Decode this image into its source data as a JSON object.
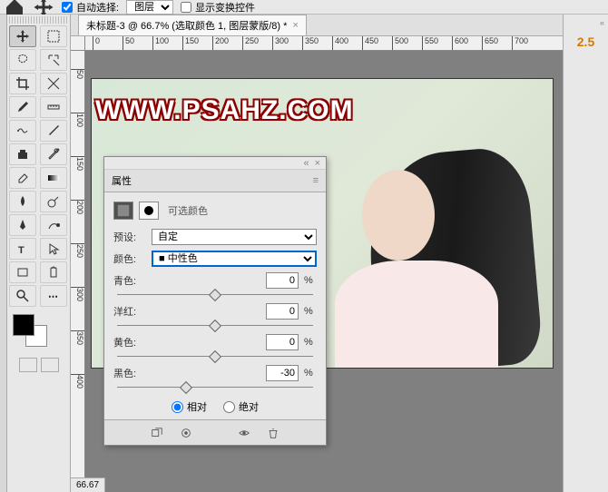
{
  "topbar": {
    "auto_select_label": "自动选择:",
    "layer_dropdown": "图层",
    "show_transform_label": "显示变换控件"
  },
  "document": {
    "tab_title": "未标题-3 @ 66.7% (选取颜色 1, 图层蒙版/8) *",
    "zoom": "66.67"
  },
  "ruler_h_ticks": [
    0,
    50,
    100,
    150,
    200,
    250,
    300,
    350,
    400,
    450,
    500,
    550,
    600,
    650,
    700
  ],
  "ruler_v_ticks": [
    50,
    100,
    150,
    200,
    250,
    300,
    350,
    400
  ],
  "watermark_text": "WWW.PSAHZ.COM",
  "right_panel": {
    "value": "2.5"
  },
  "properties": {
    "panel_title": "属性",
    "adjustment_name": "可选颜色",
    "preset_label": "预设:",
    "preset_value": "自定",
    "color_label": "颜色:",
    "color_value": "中性色",
    "sliders": [
      {
        "label": "青色:",
        "value": "0",
        "pos": 50
      },
      {
        "label": "洋红:",
        "value": "0",
        "pos": 50
      },
      {
        "label": "黄色:",
        "value": "0",
        "pos": 50
      },
      {
        "label": "黑色:",
        "value": "-30",
        "pos": 35
      }
    ],
    "radio_relative": "相对",
    "radio_absolute": "绝对"
  }
}
